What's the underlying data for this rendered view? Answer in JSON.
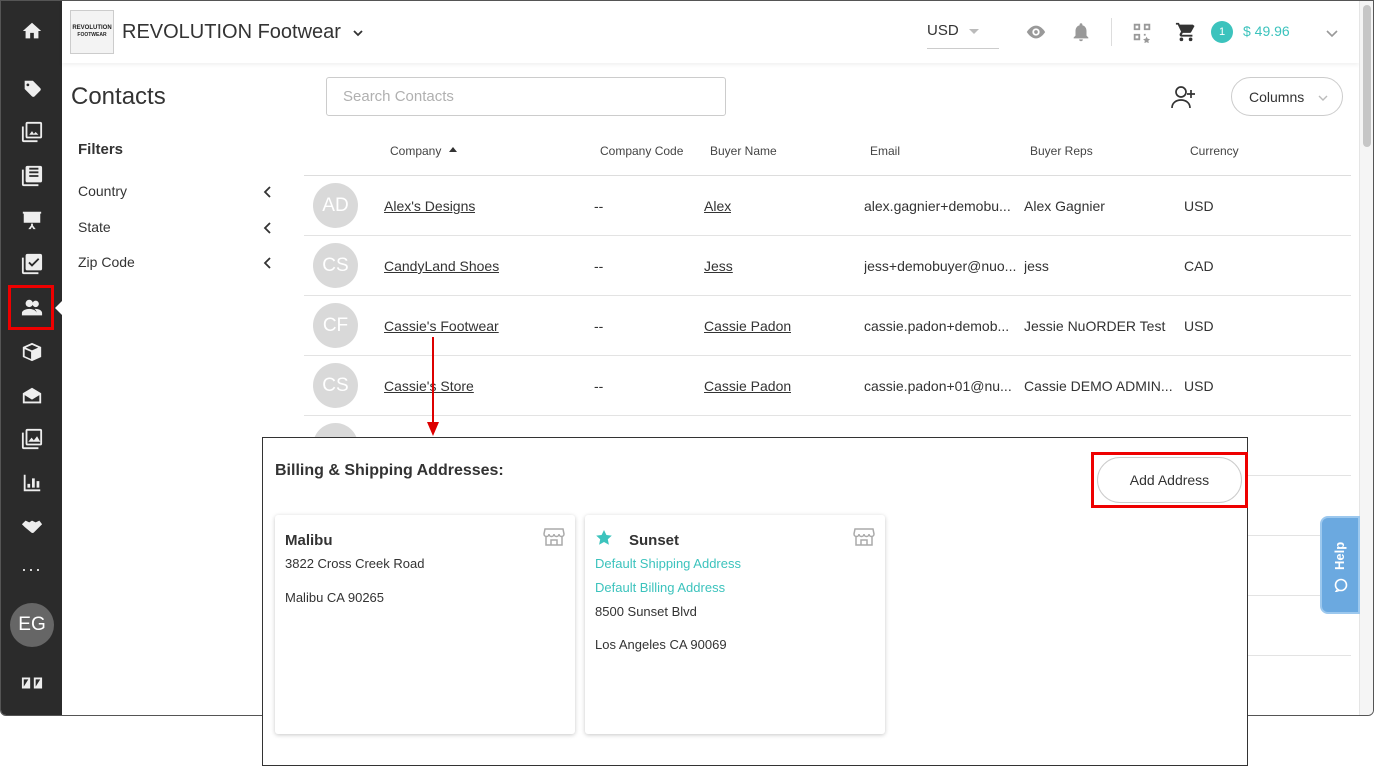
{
  "header": {
    "logo_text": [
      "REVOLUTION",
      "FOOTWEAR"
    ],
    "brand_name": "REVOLUTION Footwear",
    "currency": "USD",
    "cart_count": "1",
    "cart_total": "$ 49.96"
  },
  "sidebar": {
    "avatar_initials": "EG",
    "more": "···"
  },
  "page": {
    "title": "Contacts",
    "search_placeholder": "Search Contacts",
    "columns_label": "Columns"
  },
  "filters": {
    "title": "Filters",
    "items": [
      "Country",
      "State",
      "Zip Code"
    ]
  },
  "table": {
    "headers": [
      "Company",
      "Company Code",
      "Buyer Name",
      "Email",
      "Buyer Reps",
      "Currency"
    ],
    "rows": [
      {
        "initials": "AD",
        "company": "Alex's Designs",
        "code": "--",
        "buyer": "Alex",
        "email": "alex.gagnier+demobu...",
        "reps": "Alex Gagnier",
        "currency": "USD"
      },
      {
        "initials": "CS",
        "company": "CandyLand Shoes",
        "code": "--",
        "buyer": "Jess",
        "email": "jess+demobuyer@nuo...",
        "reps": "jess",
        "currency": "CAD"
      },
      {
        "initials": "CF",
        "company": "Cassie's Footwear",
        "code": "--",
        "buyer": "Cassie Padon",
        "email": "cassie.padon+demob...",
        "reps": "Jessie NuORDER Test",
        "currency": "USD"
      },
      {
        "initials": "CS",
        "company": "Cassie's Store",
        "code": "--",
        "buyer": "Cassie Padon",
        "email": "cassie.padon+01@nu...",
        "reps": "Cassie DEMO ADMIN...",
        "currency": "USD"
      }
    ]
  },
  "help": {
    "label": "Help"
  },
  "addresses": {
    "title": "Billing & Shipping Addresses:",
    "add_label": "Add Address",
    "cards": [
      {
        "name": "Malibu",
        "street": "3822 Cross Creek Road",
        "city": "Malibu CA 90265"
      },
      {
        "name": "Sunset",
        "default_shipping": "Default Shipping Address",
        "default_billing": "Default Billing Address",
        "street": "8500 Sunset Blvd",
        "city": "Los Angeles CA 90069"
      }
    ]
  },
  "colors": {
    "accent": "#3cc3bd",
    "highlight": "#e00000",
    "sidebar": "#2b2b2b"
  }
}
